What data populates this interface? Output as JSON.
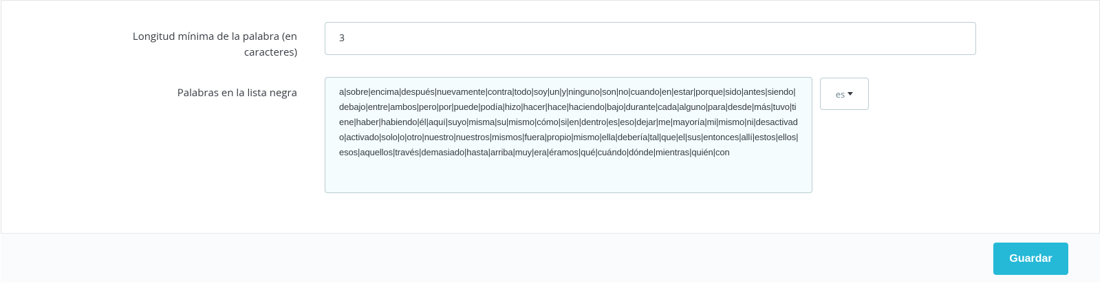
{
  "form": {
    "min_length": {
      "label": "Longitud mínima de la palabra (en caracteres)",
      "value": "3"
    },
    "blacklist": {
      "label": "Palabras en la lista negra",
      "value": "a|sobre|encima|después|nuevamente|contra|todo|soy|un|y|ninguno|son|no|cuando|en|estar|porque|sido|antes|siendo|debajo|entre|ambos|pero|por|puede|podía|hizo|hacer|hace|haciendo|bajo|durante|cada|alguno|para|desde|más|tuvo|tiene|haber|habiendo|él|aquí|suyo|misma|su|mismo|cómo|si|en|dentro|es|eso|dejar|me|mayoría|mi|mismo|ni|desactivado|activado|solo|o|otro|nuestro|nuestros|mismos|fuera|propio|mismo|ella|debería|tal|que|el|sus|entonces|allí|estos|ellos|esos|aquellos|través|demasiado|hasta|arriba|muy|era|éramos|qué|cuándo|dónde|mientras|quién|con",
      "language": "es"
    }
  },
  "footer": {
    "save_label": "Guardar"
  },
  "colors": {
    "accent": "#25b9d7",
    "textarea_bg": "#f4fcfd"
  }
}
